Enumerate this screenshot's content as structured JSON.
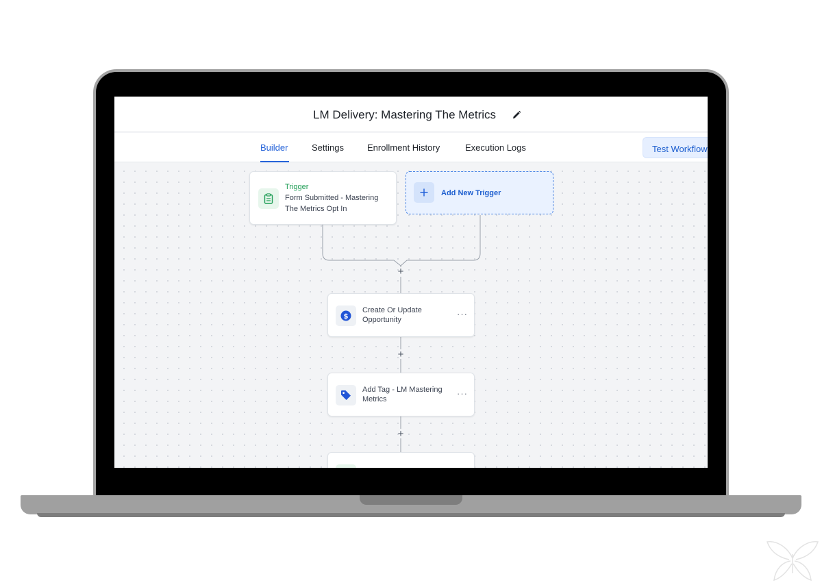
{
  "workflow": {
    "title": "LM Delivery: Mastering The Metrics"
  },
  "tabs": [
    {
      "label": "Builder",
      "active": true
    },
    {
      "label": "Settings",
      "active": false
    },
    {
      "label": "Enrollment History",
      "active": false
    },
    {
      "label": "Execution Logs",
      "active": false
    }
  ],
  "actions": {
    "test_workflow": "Test Workflow"
  },
  "trigger": {
    "heading": "Trigger",
    "line1": "Form Submitted - Mastering",
    "line2": "The Metrics Opt In",
    "icon": "clipboard-icon"
  },
  "add_trigger": {
    "label": "Add New Trigger",
    "icon": "plus-icon"
  },
  "steps": [
    {
      "line1": "Create Or Update",
      "line2": "Opportunity",
      "icon": "dollar-icon",
      "menu": "···"
    },
    {
      "line1": "Add Tag - LM Mastering",
      "line2": "Metrics",
      "icon": "tag-icon",
      "menu": "···"
    },
    {
      "line1": "",
      "line2": "",
      "icon": "",
      "menu": ""
    }
  ],
  "connector_symbol": "+",
  "colors": {
    "accent": "#2563d9",
    "trigger_green": "#1f9d55",
    "canvas": "#f3f4f6"
  }
}
